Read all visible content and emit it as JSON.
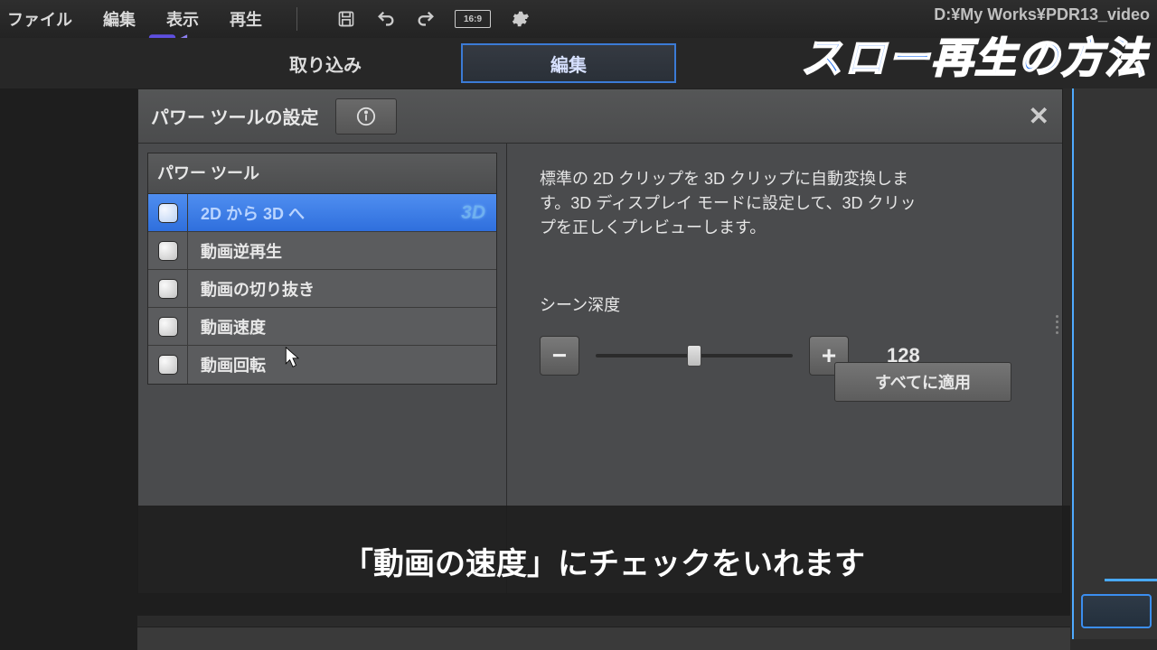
{
  "menu": {
    "file": "ファイル",
    "edit": "編集",
    "view": "表示",
    "play": "再生",
    "aspect": "16:9"
  },
  "path": "D:¥My Works¥PDR13_video",
  "tabs": {
    "import": "取り込み",
    "edit": "編集"
  },
  "overlay_title": "スロー再生の方法",
  "panel": {
    "title": "パワー ツールの設定"
  },
  "list": {
    "header": "パワー ツール",
    "items": [
      {
        "label": "2D から 3D へ",
        "selected": true,
        "badge": "3D"
      },
      {
        "label": "動画逆再生"
      },
      {
        "label": "動画の切り抜き"
      },
      {
        "label": "動画速度"
      },
      {
        "label": "動画回転"
      }
    ]
  },
  "desc": "標準の 2D クリップを 3D クリップに自動変換します。3D ディスプレイ モードに設定して、3D クリップを正しくプレビューします。",
  "slider": {
    "label": "シーン深度",
    "value": "128"
  },
  "apply": "すべてに適用",
  "subtitle": "「動画の速度」にチェックをいれます"
}
